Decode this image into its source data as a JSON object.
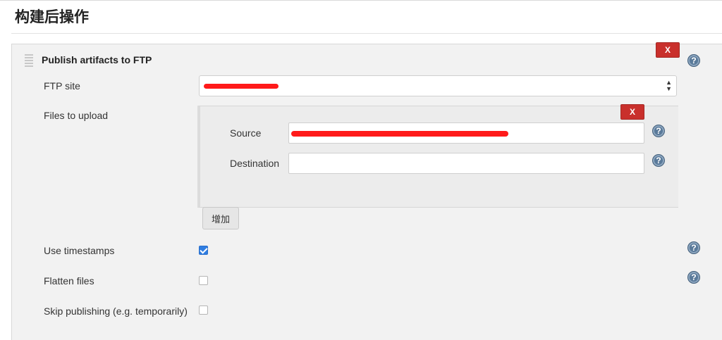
{
  "section": {
    "title": "构建后操作"
  },
  "publisher": {
    "title": "Publish artifacts to FTP",
    "delete_label": "X",
    "help_label": "?"
  },
  "ftp_site": {
    "label": "FTP site",
    "selected_value": ""
  },
  "files": {
    "label": "Files to upload",
    "delete_label": "X",
    "source": {
      "label": "Source",
      "value": ""
    },
    "destination": {
      "label": "Destination",
      "value": ""
    },
    "add_label": "增加"
  },
  "options": [
    {
      "label": "Use timestamps",
      "checked": true
    },
    {
      "label": "Flatten files",
      "checked": false
    },
    {
      "label": "Skip publishing (e.g. temporarily)",
      "checked": false
    }
  ],
  "colors": {
    "delete_button": "#c9302c",
    "checkbox_checked": "#2f7de1",
    "redaction": "#ff1a1a",
    "help_icon": "#5a7a9a"
  }
}
